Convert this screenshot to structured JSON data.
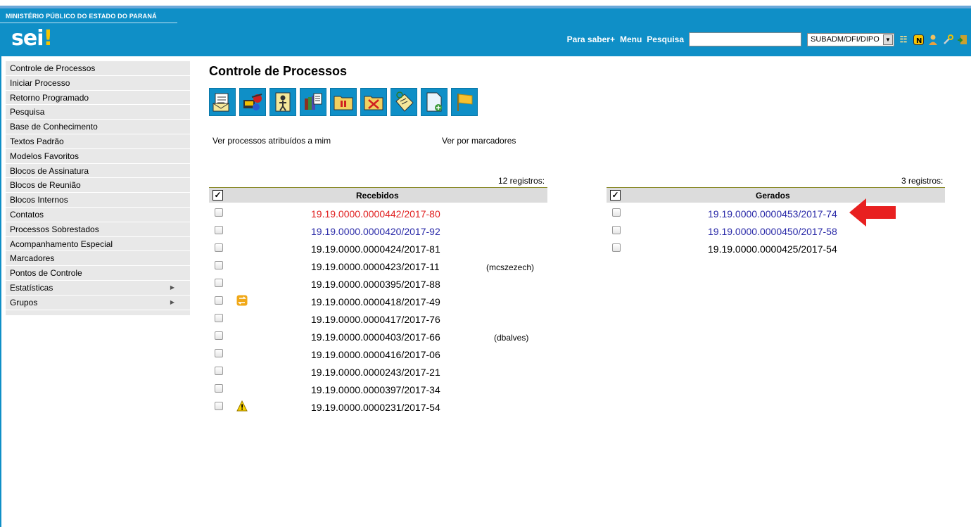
{
  "header": {
    "org": "MINISTÉRIO PÚBLICO DO ESTADO DO PARANÁ",
    "logo_text": "sei",
    "logo_mark": "!",
    "links": [
      "Para saber+",
      "Menu",
      "Pesquisa"
    ],
    "search_value": "",
    "unit": "SUBADM/DFI/DIPO",
    "icons": [
      "list-icon",
      "notes-icon",
      "user-icon",
      "settings-icon",
      "exit-icon"
    ]
  },
  "sidebar": {
    "items": [
      {
        "label": "Controle de Processos",
        "has_sub": false
      },
      {
        "label": "Iniciar Processo",
        "has_sub": false
      },
      {
        "label": "Retorno Programado",
        "has_sub": false
      },
      {
        "label": "Pesquisa",
        "has_sub": false
      },
      {
        "label": "Base de Conhecimento",
        "has_sub": false
      },
      {
        "label": "Textos Padrão",
        "has_sub": false
      },
      {
        "label": "Modelos Favoritos",
        "has_sub": false
      },
      {
        "label": "Blocos de Assinatura",
        "has_sub": false
      },
      {
        "label": "Blocos de Reunião",
        "has_sub": false
      },
      {
        "label": "Blocos Internos",
        "has_sub": false
      },
      {
        "label": "Contatos",
        "has_sub": false
      },
      {
        "label": "Processos Sobrestados",
        "has_sub": false
      },
      {
        "label": "Acompanhamento Especial",
        "has_sub": false
      },
      {
        "label": "Marcadores",
        "has_sub": false
      },
      {
        "label": "Pontos de Controle",
        "has_sub": false
      },
      {
        "label": "Estatísticas",
        "has_sub": true
      },
      {
        "label": "Grupos",
        "has_sub": true
      }
    ]
  },
  "main": {
    "title": "Controle de Processos",
    "toolbar": [
      "send-process-icon",
      "update-progress-icon",
      "assign-process-icon",
      "include-block-icon",
      "sobrestar-icon",
      "conclude-process-icon",
      "annotation-icon",
      "new-document-icon",
      "marker-icon"
    ],
    "view_links": [
      "Ver processos atribuídos a mim",
      "Ver por marcadores"
    ],
    "received": {
      "count_label": "12 registros:",
      "header": "Recebidos",
      "rows": [
        {
          "number": "19.19.0000.0000442/2017-80",
          "color": "#e02020",
          "assignee": "",
          "icon": ""
        },
        {
          "number": "19.19.0000.0000420/2017-92",
          "color": "#2a2aa8",
          "assignee": "",
          "icon": ""
        },
        {
          "number": "19.19.0000.0000424/2017-81",
          "color": "#000000",
          "assignee": "",
          "icon": ""
        },
        {
          "number": "19.19.0000.0000423/2017-11",
          "color": "#000000",
          "assignee": "(mcszezech)",
          "icon": ""
        },
        {
          "number": "19.19.0000.0000395/2017-88",
          "color": "#000000",
          "assignee": "",
          "icon": ""
        },
        {
          "number": "19.19.0000.0000418/2017-49",
          "color": "#000000",
          "assignee": "",
          "icon": "transfer-icon"
        },
        {
          "number": "19.19.0000.0000417/2017-76",
          "color": "#000000",
          "assignee": "",
          "icon": ""
        },
        {
          "number": "19.19.0000.0000403/2017-66",
          "color": "#000000",
          "assignee": "(dbalves)",
          "icon": ""
        },
        {
          "number": "19.19.0000.0000416/2017-06",
          "color": "#000000",
          "assignee": "",
          "icon": ""
        },
        {
          "number": "19.19.0000.0000243/2017-21",
          "color": "#000000",
          "assignee": "",
          "icon": ""
        },
        {
          "number": "19.19.0000.0000397/2017-34",
          "color": "#000000",
          "assignee": "",
          "icon": ""
        },
        {
          "number": "19.19.0000.0000231/2017-54",
          "color": "#000000",
          "assignee": "",
          "icon": "warning-icon"
        }
      ]
    },
    "generated": {
      "count_label": "3 registros:",
      "header": "Gerados",
      "rows": [
        {
          "number": "19.19.0000.0000453/2017-74",
          "color": "#2a2aa8"
        },
        {
          "number": "19.19.0000.0000450/2017-58",
          "color": "#2a2aa8"
        },
        {
          "number": "19.19.0000.0000425/2017-54",
          "color": "#000000"
        }
      ]
    }
  }
}
